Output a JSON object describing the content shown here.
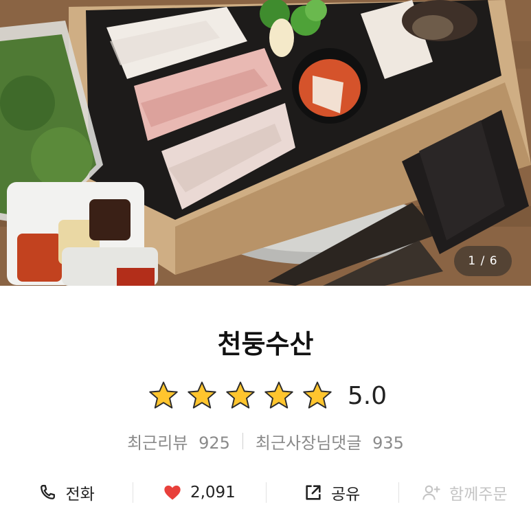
{
  "gallery": {
    "current_page": "1",
    "total_pages": "6",
    "pager_text": "1 / 6"
  },
  "store": {
    "name": "천둥수산",
    "rating": "5.0",
    "stars": 5,
    "max_stars": 5,
    "recent_reviews_label": "최근리뷰",
    "recent_reviews_count": "925",
    "owner_replies_label": "최근사장님댓글",
    "owner_replies_count": "935"
  },
  "actions": {
    "call_label": "전화",
    "like_count": "2,091",
    "share_label": "공유",
    "group_order_label": "함께주문"
  },
  "colors": {
    "star": "#ffc52e",
    "heart": "#e8403b",
    "muted_text": "#8a8a8a",
    "disabled_text": "#c4c4c4"
  },
  "icons": {
    "call": "phone-icon",
    "like": "heart-icon",
    "share": "share-icon",
    "group_order": "add-person-icon"
  }
}
